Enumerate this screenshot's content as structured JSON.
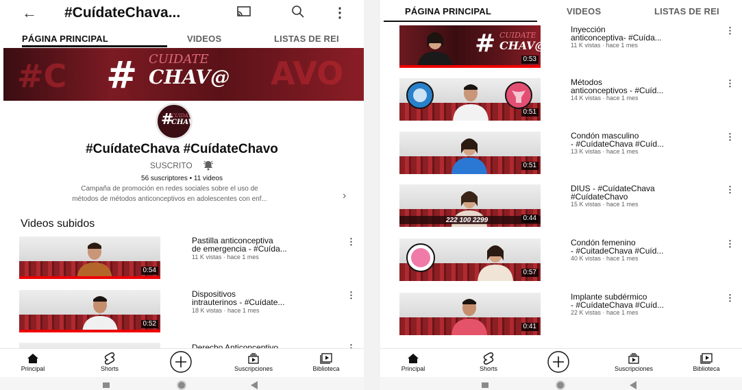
{
  "left": {
    "header": {
      "title": "#CuídateChava..."
    },
    "tabs": [
      "PÁGINA PRINCIPAL",
      "VIDEOS",
      "LISTAS DE REI"
    ],
    "channel": {
      "name": "#CuídateChava #CuídateChavo",
      "subscribed_label": "SUSCRITO",
      "stats": "56 suscriptores • 11 videos",
      "description_line1": "Campaña de promoción en redes sociales sobre el uso de",
      "description_line2": "métodos de métodos anticonceptivos en adolescentes con enf..."
    },
    "section_title": "Videos subidos",
    "videos": [
      {
        "title": "Pastilla anticonceptiva\nde emergencia - #Cuída...",
        "meta": "11 K vistas · hace 1 mes",
        "duration": "0:54"
      },
      {
        "title": "Dispositivos\nintrauterinos - #Cuídate...",
        "meta": "18 K vistas · hace 1 mes",
        "duration": "0:52"
      },
      {
        "title": "Derecho Anticonceptivo",
        "meta": "",
        "duration": ""
      }
    ],
    "nav": [
      "Principal",
      "Shorts",
      "",
      "Suscripciones",
      "Biblioteca"
    ]
  },
  "right": {
    "tabs": [
      "PÁGINA PRINCIPAL",
      "VIDEOS",
      "LISTAS DE REI"
    ],
    "videos": [
      {
        "title": "Inyección\nanticonceptiva- #Cuída...",
        "meta": "11 K vistas · hace 1 mes",
        "duration": "0:53"
      },
      {
        "title": "Métodos\nanticonceptivos - #Cuíd...",
        "meta": "14 K vistas · hace 1 mes",
        "duration": "0:51"
      },
      {
        "title": "Condón masculino\n- #CuídateChava #Cuíd...",
        "meta": "13 K vistas · hace 1 mes",
        "duration": "0:51"
      },
      {
        "title": "DIUS - #CuídateChava\n#CuídateChavo",
        "meta": "15 K vistas · hace 1 mes",
        "duration": "0:44"
      },
      {
        "title": "Condón femenino\n- #CuitadeChava #Cuíd...",
        "meta": "40 K vistas · hace 1 mes",
        "duration": "0:57"
      },
      {
        "title": "Implante subdérmico\n- #CuídateChava #Cuíd...",
        "meta": "22 K vistas · hace 1 mes",
        "duration": "0:41"
      }
    ],
    "phone_overlay": "222 100 2299",
    "nav": [
      "Principal",
      "Shorts",
      "",
      "Suscripciones",
      "Biblioteca"
    ]
  },
  "logo": {
    "hash": "#",
    "top": "CUIDATE",
    "bottom": "CHAV@"
  },
  "colors": {
    "accent": "#ff0000",
    "banner": "#7b1a22"
  }
}
